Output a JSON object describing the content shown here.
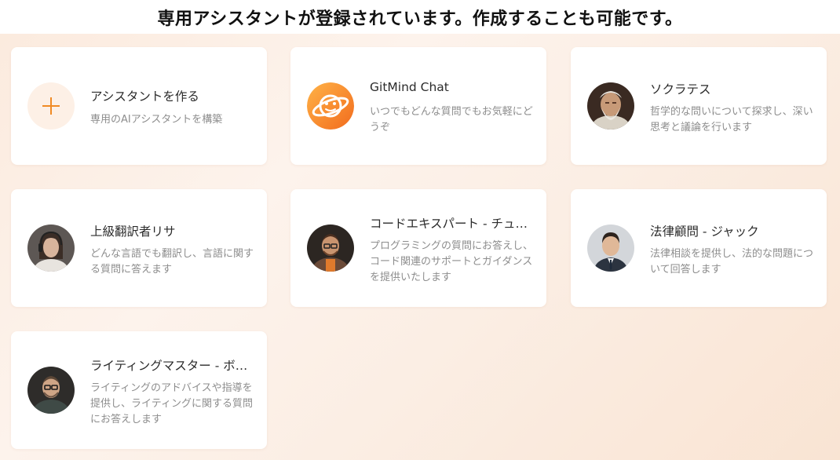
{
  "banner": {
    "text": "専用アシスタントが登録されています。作成することも可能です。"
  },
  "create_card": {
    "title": "アシスタントを作る",
    "desc": "専用のAIアシスタントを構築"
  },
  "assistants": [
    {
      "title": "GitMind Chat",
      "desc": "いつでもどんな質問でもお気軽にどうぞ",
      "icon": "gitmind-logo-icon"
    },
    {
      "title": "ソクラテス",
      "desc": "哲学的な問いについて探求し、深い思考と議論を行います",
      "icon": "socrates-avatar"
    },
    {
      "title": "上級翻訳者リサ",
      "desc": "どんな言語でも翻訳し、言語に関する質問に答えます",
      "icon": "lisa-avatar"
    },
    {
      "title": "コードエキスパート - チュ…",
      "desc": "プログラミングの質問にお答えし、コード関連のサポートとガイダンスを提供いたします",
      "icon": "code-expert-avatar"
    },
    {
      "title": "法律顧問 - ジャック",
      "desc": "法律相談を提供し、法的な問題について回答します",
      "icon": "jack-avatar"
    },
    {
      "title": "ライティングマスター - ボ…",
      "desc": "ライティングのアドバイスや指導を提供し、ライティングに関する質問にお答えします",
      "icon": "writing-master-avatar"
    }
  ],
  "colors": {
    "accent": "#f08a24",
    "page_bg": "#fcefe5",
    "card_bg": "#ffffff"
  }
}
